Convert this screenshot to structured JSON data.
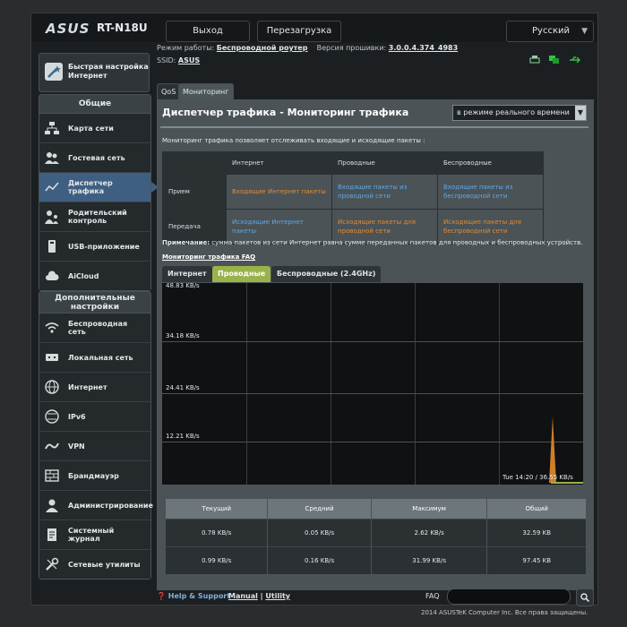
{
  "header": {
    "brand": "ASUS",
    "model": "RT-N18U",
    "logout": "Выход",
    "reboot": "Перезагрузка",
    "language": "Русский"
  },
  "info": {
    "mode_label": "Режим работы:",
    "mode_value": "Беспроводной роутер",
    "firmware_label": "Версия прошивки:",
    "firmware_value": "3.0.0.4.374_4983",
    "ssid_label": "SSID:",
    "ssid_value": "ASUS"
  },
  "sidebar": {
    "quick_setup": "Быстрая настройка Интернет",
    "general_title": "Общие",
    "general_items": [
      {
        "label": "Карта сети",
        "icon": "network-map-icon"
      },
      {
        "label": "Гостевая сеть",
        "icon": "guest-network-icon"
      },
      {
        "label": "Диспетчер трафика",
        "icon": "traffic-manager-icon"
      },
      {
        "label": "Родительский контроль",
        "icon": "parental-control-icon"
      },
      {
        "label": "USB-приложение",
        "icon": "usb-icon"
      },
      {
        "label": "AiCloud",
        "icon": "cloud-icon"
      }
    ],
    "advanced_title": "Дополнительные настройки",
    "advanced_items": [
      {
        "label": "Беспроводная сеть",
        "icon": "wifi-icon"
      },
      {
        "label": "Локальная сеть",
        "icon": "lan-icon"
      },
      {
        "label": "Интернет",
        "icon": "globe-icon"
      },
      {
        "label": "IPv6",
        "icon": "ipv6-icon"
      },
      {
        "label": "VPN",
        "icon": "vpn-icon"
      },
      {
        "label": "Брандмауэр",
        "icon": "firewall-icon"
      },
      {
        "label": "Администрирование",
        "icon": "admin-icon"
      },
      {
        "label": "Системный журнал",
        "icon": "log-icon"
      },
      {
        "label": "Сетевые утилиты",
        "icon": "tools-icon"
      }
    ]
  },
  "tabs": {
    "qos": "QoS",
    "monitor": "Мониторинг трафика"
  },
  "page": {
    "title": "Диспетчер трафика - Мониторинг трафика",
    "mode_select": "в режиме реального времени",
    "description": "Мониторинг трафика позволяет отслеживать входящие и исходящие пакеты :",
    "table": {
      "headers": [
        "Интернет",
        "Проводные",
        "Беспроводные"
      ],
      "rows": [
        {
          "label": "Прием",
          "cells": [
            "Входящие Интернет пакеты",
            "Входящие пакеты из проводной сети",
            "Входящие пакеты из беспроводной сети"
          ]
        },
        {
          "label": "Передача",
          "cells": [
            "Исходящие Интернет пакеты",
            "Исходящие пакеты для проводной сети",
            "Исходящие пакеты для беспроводной сети"
          ]
        }
      ]
    },
    "note_label": "Примечание:",
    "note_text": "сумма пакетов из сети Интернет равна сумме переданных пакетов для проводных и беспроводных устройств.",
    "faq_link": "Мониторинг трафика FAQ",
    "graph_tabs": [
      "Интернет",
      "Проводные",
      "Беспроводные (2.4GHz)"
    ],
    "graph": {
      "y_labels": [
        "48.83 KB/s",
        "34.18 KB/s",
        "24.41 KB/s",
        "12.21 KB/s"
      ],
      "timestamp": "Tue 14:20 / 36.55 KB/s"
    },
    "summary": {
      "headers": [
        "Текущий",
        "Средний",
        "Максимум",
        "Общий"
      ],
      "rows": [
        [
          "0.78 KB/s",
          "0.05 KB/s",
          "2.62 KB/s",
          "32.59 KB"
        ],
        [
          "0.99 KB/s",
          "0.16 KB/s",
          "31.99 KB/s",
          "97.45 KB"
        ]
      ]
    }
  },
  "footer": {
    "help": "Help & Support",
    "manual": "Manual",
    "utility": "Utility",
    "faq": "FAQ",
    "copyright": "2014 ASUSTeK Computer Inc. Все права защищены."
  },
  "colors": {
    "active_tab": "#9ab24a",
    "incoming": "#5ea9e8",
    "outgoing": "#e58b2c",
    "active_nav": "#3f5f82"
  }
}
